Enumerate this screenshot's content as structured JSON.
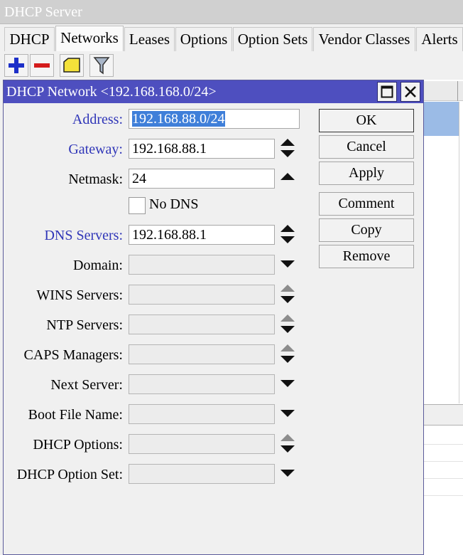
{
  "window": {
    "title": "DHCP Server"
  },
  "tabs": [
    {
      "label": "DHCP"
    },
    {
      "label": "Networks"
    },
    {
      "label": "Leases"
    },
    {
      "label": "Options"
    },
    {
      "label": "Option Sets"
    },
    {
      "label": "Vendor Classes"
    },
    {
      "label": "Alerts"
    }
  ],
  "toolbar": {
    "icons": [
      "add-icon",
      "remove-icon",
      "comment-icon",
      "filter-icon"
    ]
  },
  "colors": {
    "dialog_title": "#4e4fbf",
    "selection": "#3f7fd9",
    "required_label": "#3036b8"
  },
  "dialog": {
    "title": "DHCP Network <192.168.168.0/24>",
    "fields": [
      {
        "label": "Address:",
        "value": "192.168.88.0/24"
      },
      {
        "label": "Gateway:",
        "value": "192.168.88.1"
      },
      {
        "label": "Netmask:",
        "value": "24"
      },
      {
        "label": "DNS Servers:",
        "value": "192.168.88.1"
      },
      {
        "label": "Domain:",
        "value": ""
      },
      {
        "label": "WINS Servers:",
        "value": ""
      },
      {
        "label": "NTP Servers:",
        "value": ""
      },
      {
        "label": "CAPS Managers:",
        "value": ""
      },
      {
        "label": "Next Server:",
        "value": ""
      },
      {
        "label": "Boot File Name:",
        "value": ""
      },
      {
        "label": "DHCP Options:",
        "value": ""
      },
      {
        "label": "DHCP Option Set:",
        "value": ""
      }
    ],
    "no_dns": {
      "label": "No DNS",
      "checked": false
    },
    "buttons": [
      {
        "label": "OK"
      },
      {
        "label": "Cancel"
      },
      {
        "label": "Apply"
      },
      {
        "label": "Comment"
      },
      {
        "label": "Copy"
      },
      {
        "label": "Remove"
      }
    ]
  }
}
